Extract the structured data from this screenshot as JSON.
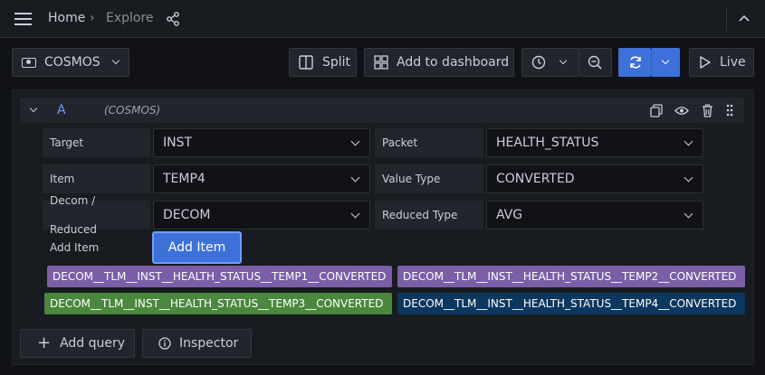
{
  "nav": {
    "home": "Home",
    "separator": "›",
    "current": "Explore"
  },
  "toolbar": {
    "datasource": "COSMOS",
    "split": "Split",
    "add_to_dashboard": "Add to dashboard",
    "live": "Live"
  },
  "query": {
    "letter": "A",
    "datasource": "(COSMOS)",
    "fields": {
      "target_label": "Target",
      "target_value": "INST",
      "packet_label": "Packet",
      "packet_value": "HEALTH_STATUS",
      "item_label": "Item",
      "item_value": "TEMP4",
      "value_type_label": "Value Type",
      "value_type_value": "CONVERTED",
      "decom_label_1": "Decom /",
      "decom_label_2": "Reduced",
      "decom_value": "DECOM",
      "reduced_type_label": "Reduced Type",
      "reduced_type_value": "AVG",
      "add_item_label": "Add Item",
      "add_item_button": "Add Item"
    },
    "items": [
      {
        "label": "DECOM__TLM__INST__HEALTH_STATUS__TEMP1__CONVERTED",
        "color": "#7b5ea7"
      },
      {
        "label": "DECOM__TLM__INST__HEALTH_STATUS__TEMP2__CONVERTED",
        "color": "#7b5ea7"
      },
      {
        "label": "DECOM__TLM__INST__HEALTH_STATUS__TEMP3__CONVERTED",
        "color": "#4b873f"
      },
      {
        "label": "DECOM__TLM__INST__HEALTH_STATUS__TEMP4__CONVERTED",
        "color": "#0c375e"
      }
    ]
  },
  "footer": {
    "add_query": "Add query",
    "inspector": "Inspector"
  },
  "colors": {
    "accent_blue": "#3d71d9",
    "query_letter": "#6e9fff"
  }
}
